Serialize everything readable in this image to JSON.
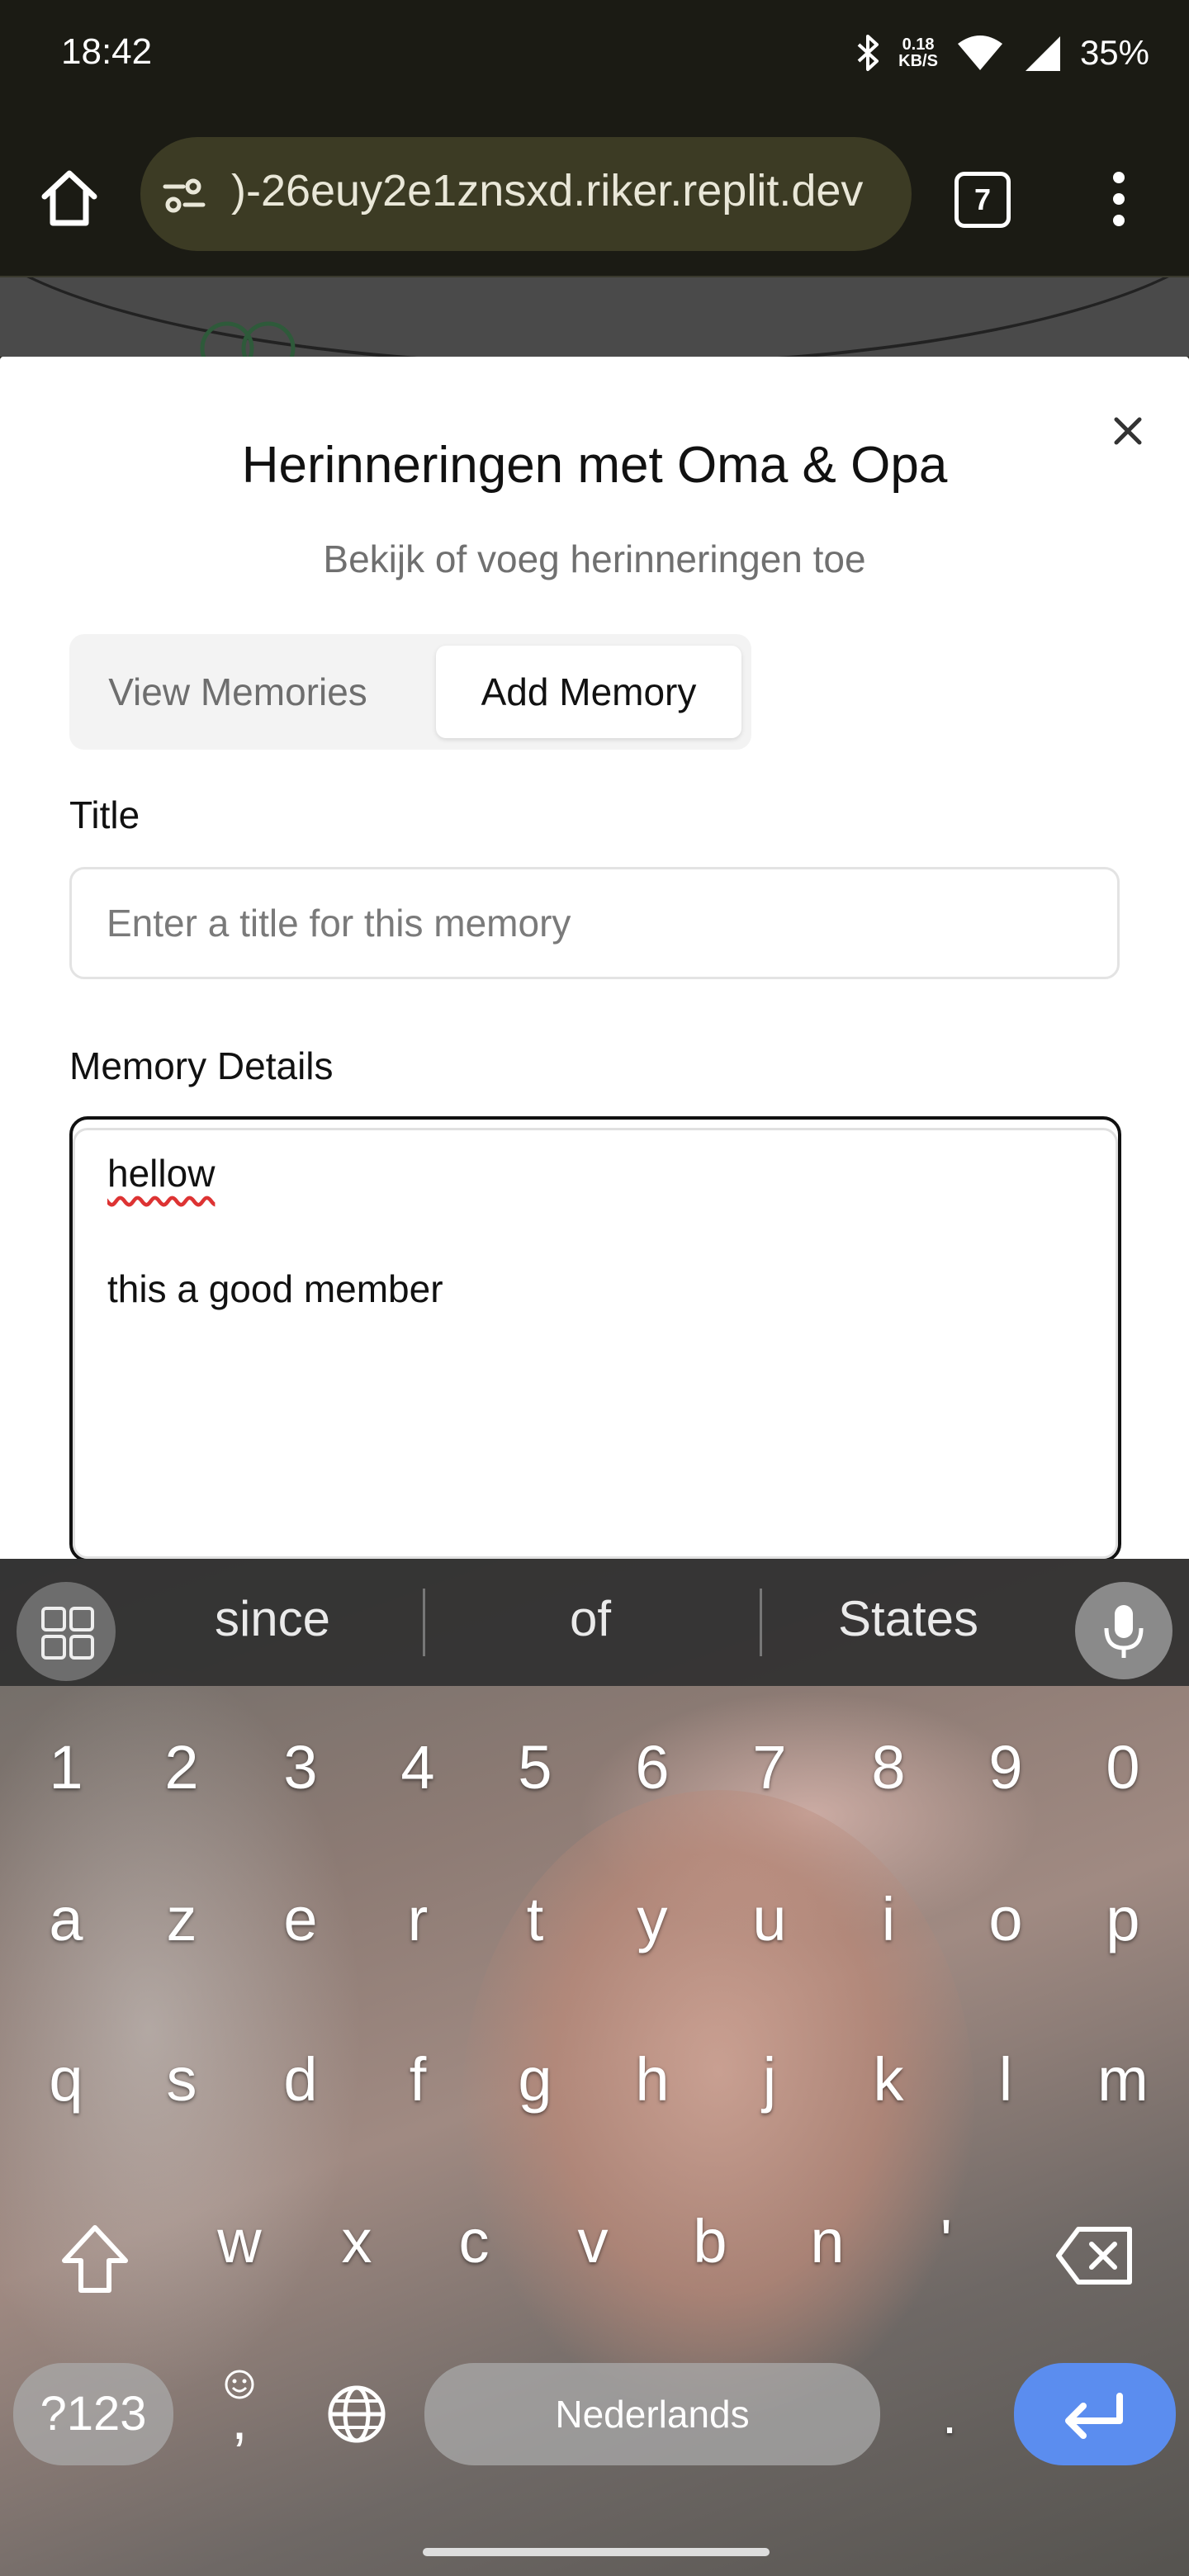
{
  "status_bar": {
    "time": "18:42",
    "net_rate_value": "0.18",
    "net_rate_unit": "KB/S",
    "battery": "35%"
  },
  "browser": {
    "url": ")-26euy2e1znsxd.riker.replit.dev",
    "tab_count": "7"
  },
  "dialog": {
    "title": "Herinneringen met Oma & Opa",
    "subtitle": "Bekijk of voeg herinneringen toe",
    "tabs": [
      {
        "label": "View Memories",
        "active": false
      },
      {
        "label": "Add Memory",
        "active": true
      }
    ],
    "title_field": {
      "label": "Title",
      "placeholder": "Enter a title for this memory",
      "value": ""
    },
    "details_field": {
      "label": "Memory Details",
      "line1": "hellow",
      "line2": "this a good member"
    }
  },
  "keyboard": {
    "suggestions": [
      "since",
      "of",
      "States"
    ],
    "number_row": [
      "1",
      "2",
      "3",
      "4",
      "5",
      "6",
      "7",
      "8",
      "9",
      "0"
    ],
    "row1": [
      "a",
      "z",
      "e",
      "r",
      "t",
      "y",
      "u",
      "i",
      "o",
      "p"
    ],
    "row2": [
      "q",
      "s",
      "d",
      "f",
      "g",
      "h",
      "j",
      "k",
      "l",
      "m"
    ],
    "row3": [
      "w",
      "x",
      "c",
      "v",
      "b",
      "n",
      "'"
    ],
    "symbols_key": "?123",
    "comma_key": ",",
    "space_label": "Nederlands",
    "period_key": "."
  },
  "colors": {
    "enter_key": "#5b8def",
    "browser_bar": "#1b1b14",
    "url_pill": "#3c3b24"
  }
}
